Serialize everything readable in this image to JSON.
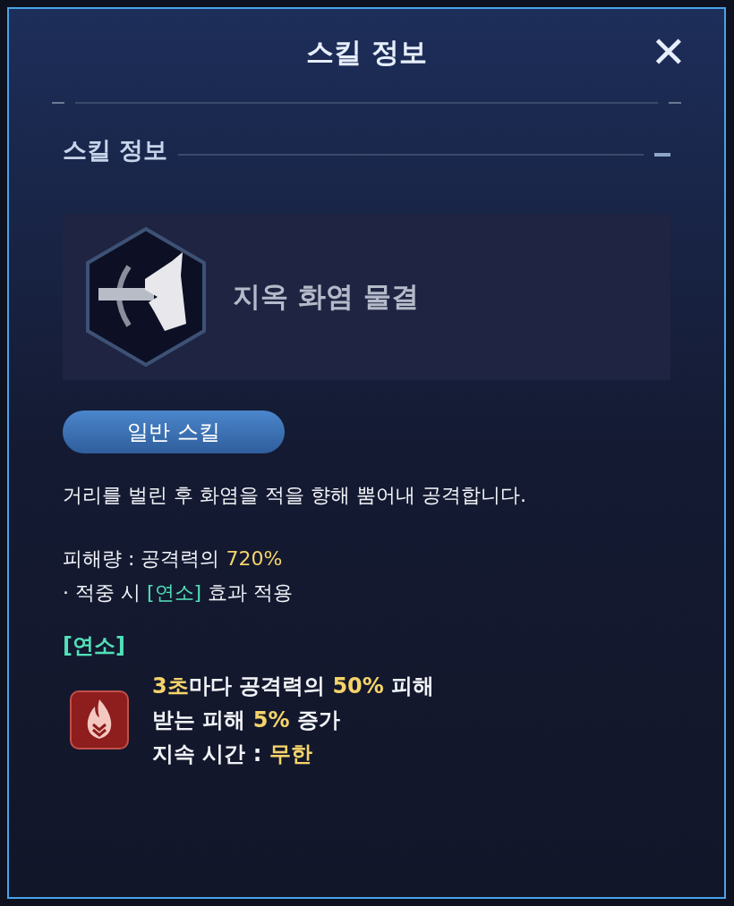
{
  "dialog": {
    "title": "스킬 정보",
    "close_label": "✕"
  },
  "section": {
    "heading": "스킬 정보"
  },
  "skill": {
    "name": "지옥 화염 물결",
    "type_button": "일반 스킬"
  },
  "description": "거리를 벌린 후 화염을 적을 향해 뿜어내 공격합니다.",
  "effects": [
    {
      "segments": [
        {
          "text": "피해량 : 공격력의 ",
          "kind": "plain"
        },
        {
          "text": "720%",
          "kind": "value"
        }
      ]
    },
    {
      "segments": [
        {
          "text": "· 적중 시 ",
          "kind": "plain"
        },
        {
          "text": "[연소]",
          "kind": "keyword"
        },
        {
          "text": " 효과 적용",
          "kind": "plain"
        }
      ]
    }
  ],
  "status_effect": {
    "title": "[연소]",
    "lines": [
      {
        "segments": [
          {
            "text": "3초",
            "kind": "value"
          },
          {
            "text": "마다 공격력의 ",
            "kind": "plain"
          },
          {
            "text": "50%",
            "kind": "value"
          },
          {
            "text": " 피해",
            "kind": "plain"
          }
        ]
      },
      {
        "segments": [
          {
            "text": "받는 피해 ",
            "kind": "plain"
          },
          {
            "text": "5%",
            "kind": "value"
          },
          {
            "text": " 증가",
            "kind": "plain"
          }
        ]
      },
      {
        "segments": [
          {
            "text": "지속 시간 : ",
            "kind": "plain"
          },
          {
            "text": "무한",
            "kind": "value"
          }
        ]
      }
    ]
  }
}
